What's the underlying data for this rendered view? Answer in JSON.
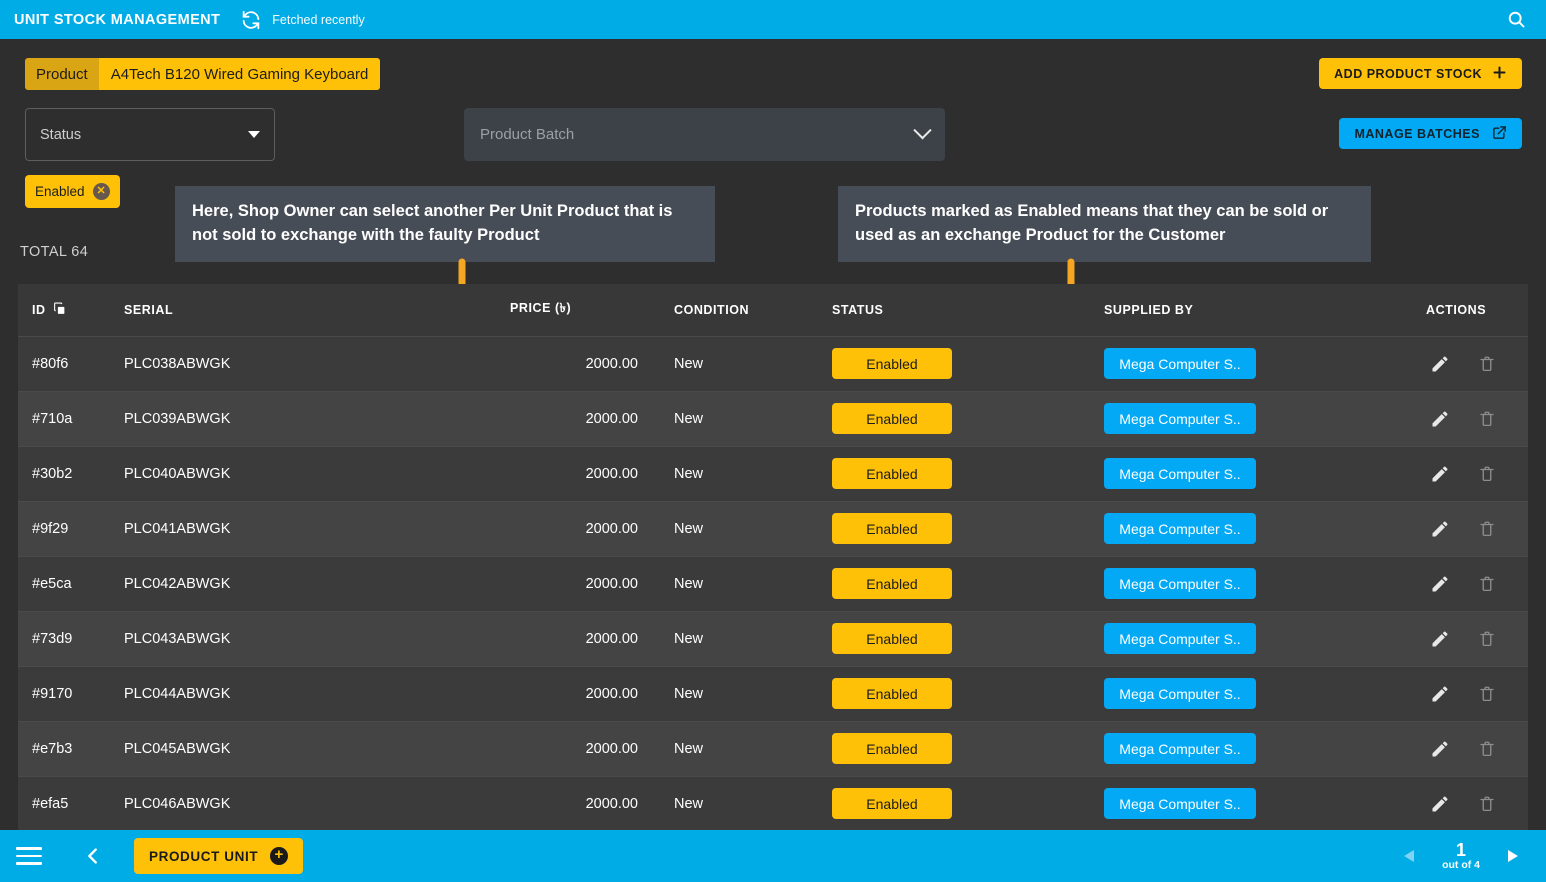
{
  "topbar": {
    "title": "UNIT STOCK MANAGEMENT",
    "refresh_icon": "refresh-icon",
    "fetched_text": "Fetched recently",
    "search_icon": "search-icon"
  },
  "product": {
    "label": "Product",
    "value": "A4Tech B120 Wired Gaming Keyboard"
  },
  "actions": {
    "add_product_stock": "ADD PRODUCT STOCK",
    "add_icon": "plus-icon",
    "manage_batches": "MANAGE BATCHES",
    "external_link_icon": "external-link-icon"
  },
  "filters": {
    "status_placeholder": "Status",
    "status_caret_icon": "caret-down-icon",
    "batch_placeholder": "Product Batch",
    "batch_caret_icon": "chevron-down-icon",
    "active_chip": "Enabled",
    "chip_remove_icon": "close-icon",
    "total_label": "TOTAL 64"
  },
  "callouts": {
    "left": "Here, Shop Owner can select another Per Unit Product that is not sold to exchange with the faulty Product",
    "right": "Products marked as Enabled means that they can be sold or used as an exchange Product for the Customer"
  },
  "table": {
    "columns": {
      "id": "ID",
      "id_copy_icon": "copy-icon",
      "serial": "SERIAL",
      "price": "PRICE (৳)",
      "condition": "CONDITION",
      "status": "STATUS",
      "supplied_by": "SUPPLIED BY",
      "actions": "ACTIONS"
    },
    "edit_icon": "pencil-icon",
    "delete_icon": "trash-icon",
    "rows": [
      {
        "id": "#80f6",
        "serial": "PLC038ABWGK",
        "price": "2000.00",
        "condition": "New",
        "status": "Enabled",
        "supplied_by": "Mega Computer S.."
      },
      {
        "id": "#710a",
        "serial": "PLC039ABWGK",
        "price": "2000.00",
        "condition": "New",
        "status": "Enabled",
        "supplied_by": "Mega Computer S.."
      },
      {
        "id": "#30b2",
        "serial": "PLC040ABWGK",
        "price": "2000.00",
        "condition": "New",
        "status": "Enabled",
        "supplied_by": "Mega Computer S.."
      },
      {
        "id": "#9f29",
        "serial": "PLC041ABWGK",
        "price": "2000.00",
        "condition": "New",
        "status": "Enabled",
        "supplied_by": "Mega Computer S.."
      },
      {
        "id": "#e5ca",
        "serial": "PLC042ABWGK",
        "price": "2000.00",
        "condition": "New",
        "status": "Enabled",
        "supplied_by": "Mega Computer S.."
      },
      {
        "id": "#73d9",
        "serial": "PLC043ABWGK",
        "price": "2000.00",
        "condition": "New",
        "status": "Enabled",
        "supplied_by": "Mega Computer S.."
      },
      {
        "id": "#9170",
        "serial": "PLC044ABWGK",
        "price": "2000.00",
        "condition": "New",
        "status": "Enabled",
        "supplied_by": "Mega Computer S.."
      },
      {
        "id": "#e7b3",
        "serial": "PLC045ABWGK",
        "price": "2000.00",
        "condition": "New",
        "status": "Enabled",
        "supplied_by": "Mega Computer S.."
      },
      {
        "id": "#efa5",
        "serial": "PLC046ABWGK",
        "price": "2000.00",
        "condition": "New",
        "status": "Enabled",
        "supplied_by": "Mega Computer S.."
      }
    ]
  },
  "bottombar": {
    "menu_icon": "hamburger-menu-icon",
    "back_icon": "chevron-left-icon",
    "product_unit": "PRODUCT UNIT",
    "product_unit_add_icon": "plus-circle-icon",
    "prev_icon": "triangle-left-icon",
    "next_icon": "triangle-right-icon",
    "page_number": "1",
    "page_out_of": "out of 4"
  },
  "colors": {
    "accent_blue": "#00ace6",
    "accent_yellow": "#ffc107",
    "supplier_blue": "#03a9f4",
    "page_bg": "#2e2e2e",
    "callout_bg": "#474d57",
    "arrow": "#f5a623"
  }
}
